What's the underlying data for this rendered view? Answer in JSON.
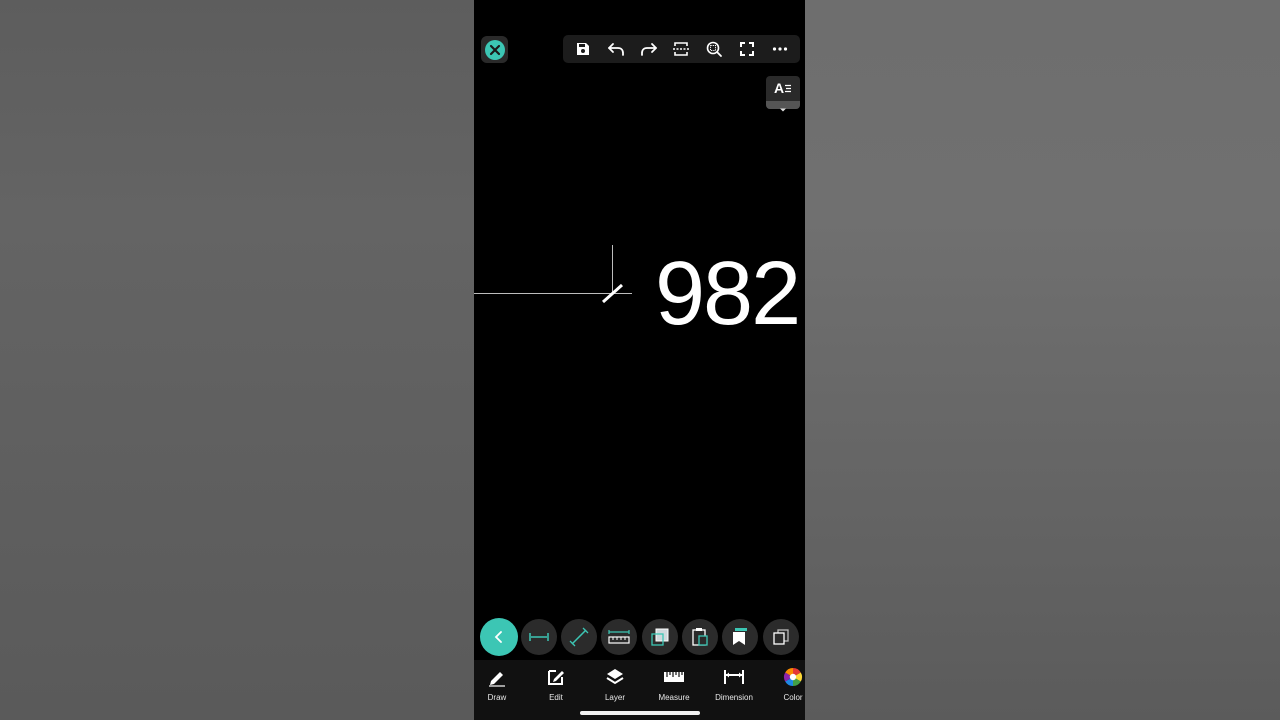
{
  "canvas": {
    "display_text": "982"
  },
  "top_toolbar": {
    "buttons": [
      {
        "name": "save",
        "icon": "floppy-disk-icon"
      },
      {
        "name": "undo",
        "icon": "undo-arrow-icon"
      },
      {
        "name": "redo",
        "icon": "redo-arrow-icon"
      },
      {
        "name": "split-view",
        "icon": "split-frame-icon"
      },
      {
        "name": "zoom",
        "icon": "zoom-magnifier-icon"
      },
      {
        "name": "fullscreen",
        "icon": "fullscreen-corners-icon"
      },
      {
        "name": "more",
        "icon": "ellipsis-icon"
      }
    ]
  },
  "text_style": {
    "label": "A"
  },
  "tool_row": {
    "items": [
      "back-chevron-icon",
      "linear-dimension-icon",
      "aligned-dimension-icon",
      "ruler-icon",
      "image-swap-icon",
      "clipboard-icon",
      "bookmark-stack-icon",
      "copy-icon"
    ]
  },
  "bottom_nav": {
    "items": [
      {
        "label": "Draw",
        "icon": "pencil-icon"
      },
      {
        "label": "Edit",
        "icon": "edit-square-icon"
      },
      {
        "label": "Layer",
        "icon": "layers-icon"
      },
      {
        "label": "Measure",
        "icon": "ruler-icon"
      },
      {
        "label": "Dimension",
        "icon": "dimension-icon"
      },
      {
        "label": "Color",
        "icon": "color-wheel-icon"
      }
    ]
  },
  "colors": {
    "accent": "#3cc6b4",
    "canvas_bg": "#000000",
    "toolbar_bg": "#1c1c1c"
  }
}
